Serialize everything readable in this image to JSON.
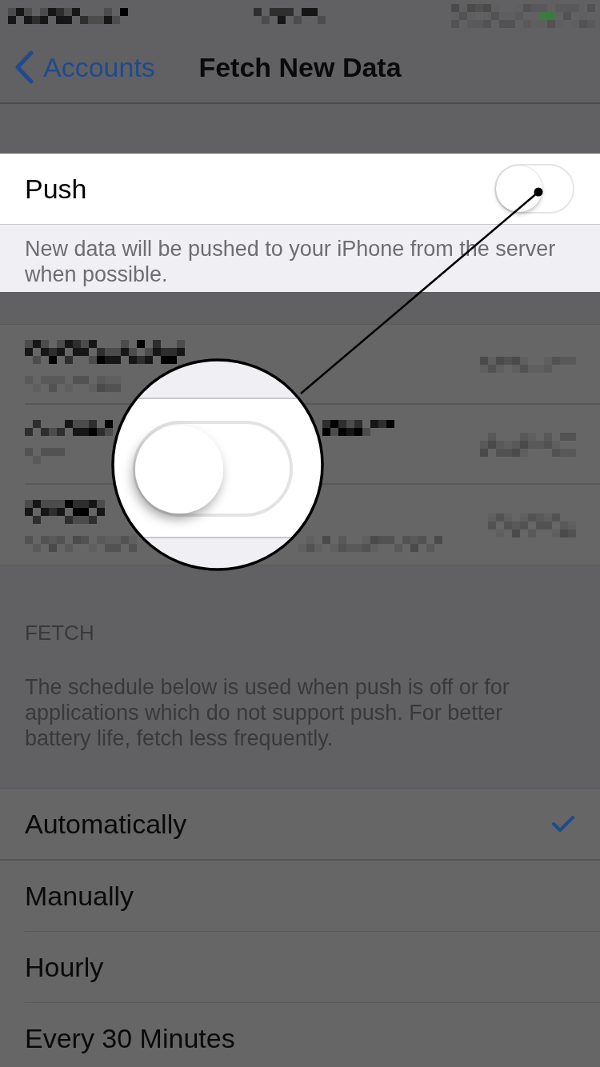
{
  "status_bar": {
    "kind": "pixelated"
  },
  "nav_bar": {
    "highlighted": false,
    "back_label": "Accounts",
    "title": "Fetch New Data"
  },
  "push_section": {
    "highlighted": true,
    "label": "Push",
    "on": false,
    "footer": "New data will be pushed to your iPhone from the server when possible."
  },
  "accounts_section": {
    "highlighted": false,
    "rows": [
      {
        "kind": "pixelated"
      },
      {
        "kind": "pixelated"
      },
      {
        "kind": "pixelated"
      }
    ]
  },
  "fetch_section": {
    "highlighted": false,
    "header": "FETCH",
    "description": "The schedule below is used when push is off or for applications which do not support push. For better battery life, fetch less frequently.",
    "options": [
      {
        "label": "Automatically",
        "selected": true
      },
      {
        "label": "Manually",
        "selected": false
      },
      {
        "label": "Hourly",
        "selected": false
      },
      {
        "label": "Every 30 Minutes",
        "selected": false
      }
    ]
  },
  "magnifier": {
    "shown": true
  }
}
